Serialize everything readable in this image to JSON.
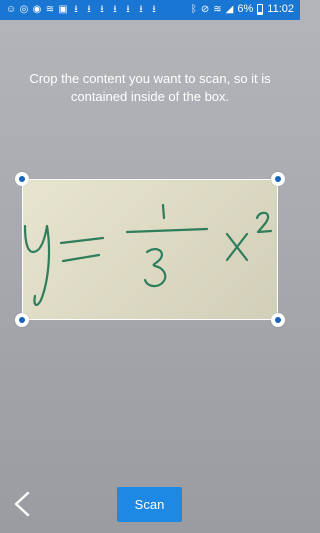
{
  "status_bar": {
    "notification_icons": [
      "app-icon",
      "whatsapp-icon",
      "messenger-icon",
      "wifi-icon",
      "image-icon",
      "download-icon",
      "download-icon",
      "download-icon",
      "download-icon",
      "download-icon",
      "download-icon",
      "download-icon"
    ],
    "system_icons": [
      "bluetooth-icon",
      "mute-icon",
      "wifi-icon",
      "signal-icon"
    ],
    "battery": "6%",
    "time": "11:02",
    "background_color": "#1976d2"
  },
  "instruction": "Crop the content you want to scan, so it is contained inside of the box.",
  "crop_content": {
    "handwriting": "y = 1/3 x²",
    "ink_color": "#2e7d5b"
  },
  "back_button_icon": "chevron-left-icon",
  "scan_button": {
    "label": "Scan",
    "color": "#1e88e5"
  }
}
